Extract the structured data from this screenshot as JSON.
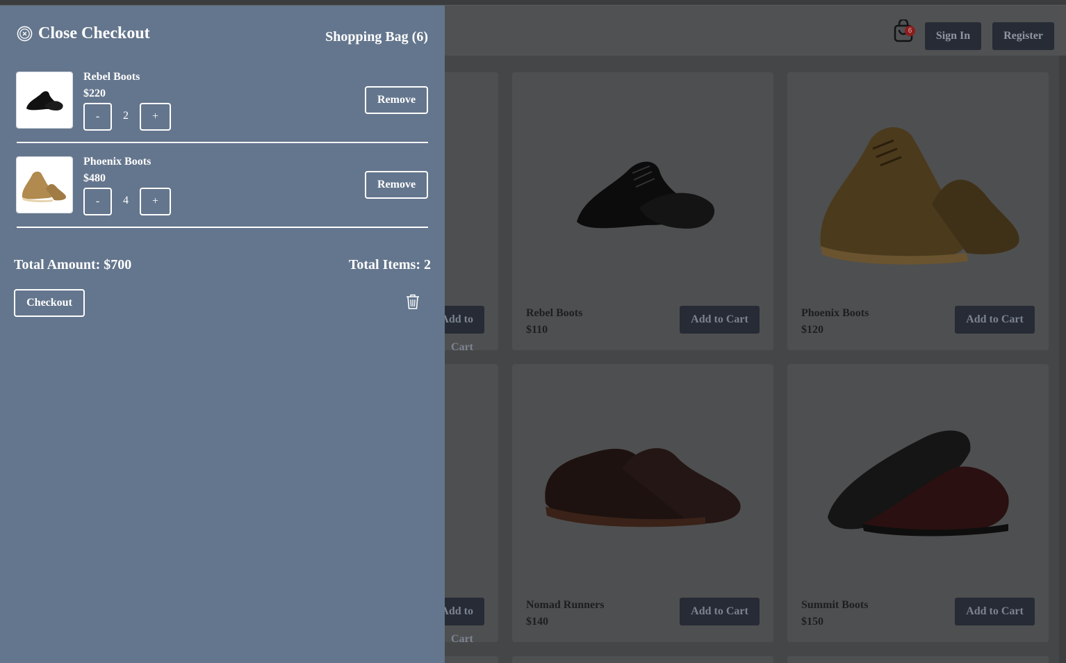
{
  "header": {
    "cart_count": "6",
    "sign_in_label": "Sign In",
    "register_label": "Register"
  },
  "products": [
    {
      "name": "Rebel Boots",
      "price": "$110",
      "button": "Add to Cart",
      "image": "black-oxford-shoe"
    },
    {
      "name": "Phoenix Boots",
      "price": "$120",
      "button": "Add to Cart",
      "image": "brown-suede-shoe"
    },
    {
      "name": "Nomad Runners",
      "price": "$140",
      "button": "Add to Cart",
      "image": "dark-brown-derby-shoe"
    },
    {
      "name": "Summit Boots",
      "price": "$150",
      "button": "Add to Cart",
      "image": "burgundy-brogue-shoe"
    }
  ],
  "partial_buttons": [
    "Add to Cart",
    "Add to Cart"
  ],
  "drawer": {
    "close_label": "Close Checkout",
    "bag_title": "Shopping Bag (6)",
    "items": [
      {
        "name": "Rebel Boots",
        "price": "$220",
        "qty": "2",
        "minus": "-",
        "plus": "+",
        "remove": "Remove",
        "image": "black-oxford-shoe"
      },
      {
        "name": "Phoenix Boots",
        "price": "$480",
        "qty": "4",
        "minus": "-",
        "plus": "+",
        "remove": "Remove",
        "image": "tan-suede-shoe"
      }
    ],
    "total_amount": "Total Amount: $700",
    "total_items": "Total Items: 2",
    "checkout_label": "Checkout",
    "colors": {
      "drawer_bg": "#64768d",
      "button_dark": "#262b35",
      "badge": "#8a1d1d"
    }
  }
}
